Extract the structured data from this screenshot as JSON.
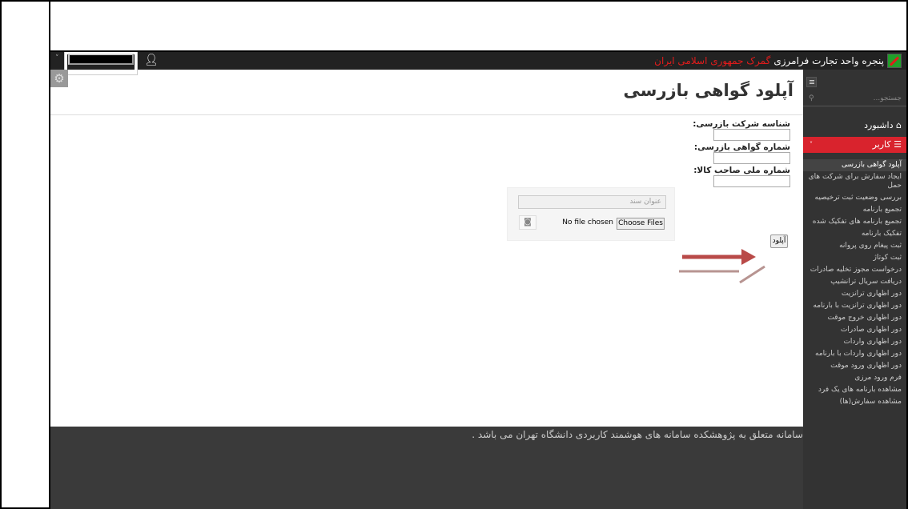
{
  "topbar": {
    "brand_prefix": "پنجره واحد تجارت فرامرزی",
    "brand_highlight": "گمرک جمهوری اسلامی ایران"
  },
  "page": {
    "title": "آپلود گواهی بازرسی"
  },
  "form": {
    "company_label": "شناسه شرکت بازرسی:",
    "company_value": "",
    "certificate_label": "شماره گواهی بازرسی:",
    "certificate_value": "",
    "national_id_label": "شماره ملی صاحب کالا:",
    "national_id_value": "",
    "doc_title_placeholder": "عنوان سند",
    "no_file_text": "No file chosen",
    "choose_files_label": "Choose Files",
    "upload_label": "آپلود"
  },
  "footer": {
    "text": "سامانه متعلق به پژوهشکده سامانه های هوشمند کاربردی دانشگاه تهران می باشد ."
  },
  "sidebar": {
    "search_placeholder": "جستجو...",
    "dashboard_label": "داشبورد",
    "user_label": "کاربر",
    "items": [
      "آپلود گواهی بازرسی",
      "ایجاد سفارش برای شرکت های حمل",
      "بررسی وضعیت ثبت ترخیصیه",
      "تجمیع بارنامه",
      "تجمیع بارنامه های تفکیک شده",
      "تفکیک بارنامه",
      "ثبت پیغام روی پروانه",
      "ثبت کوتاژ",
      "درخواست مجوز تخلیه صادرات",
      "دریافت سریال ترانشیپ",
      "دور اظهاری ترانزیت",
      "دور اظهاری ترانزیت با بارنامه",
      "دور اظهاری خروج موقت",
      "دور اظهاری صادرات",
      "دور اظهاری واردات",
      "دور اظهاری واردات با بارنامه",
      "دور اظهاری ورود موقت",
      "فرم ورود مرزی",
      "مشاهده بارنامه های یک فرد",
      "مشاهده سفارش(ها)"
    ]
  },
  "colors": {
    "accent": "#d9232d",
    "topbar": "#222222",
    "sidebar": "#333333",
    "footer": "#3a3a3a",
    "arrow": "#b94a48"
  }
}
